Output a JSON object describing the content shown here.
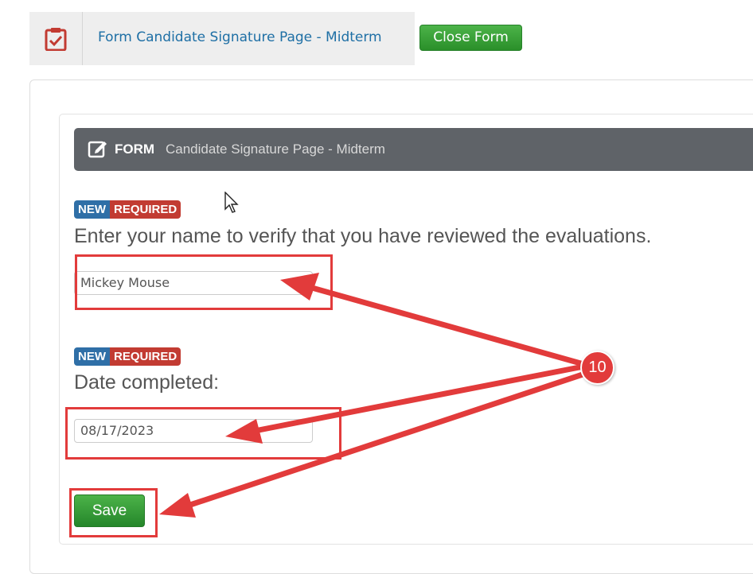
{
  "header": {
    "title": "Form Candidate Signature Page - Midterm",
    "close_button": "Close Form",
    "icon": "clipboard-check-icon",
    "icon_color": "#c23b32"
  },
  "form": {
    "header_label": "FORM",
    "header_name": "Candidate Signature Page - Midterm",
    "header_icon": "edit-icon",
    "questions": [
      {
        "badge_new": "NEW",
        "badge_required": "REQUIRED",
        "label": "Enter your name to verify that you have reviewed the evaluations.",
        "value": "Mickey Mouse"
      },
      {
        "badge_new": "NEW",
        "badge_required": "REQUIRED",
        "label": "Date completed:",
        "value": "08/17/2023"
      }
    ],
    "save_button": "Save"
  },
  "annotation": {
    "step_number": "10",
    "color": "#e23b3b"
  },
  "colors": {
    "accent_green": "#2a8f2a",
    "link_blue": "#1e6fa5",
    "badge_new": "#2f6fa7",
    "badge_required": "#c23b32",
    "form_header_bg": "#5f6368"
  }
}
